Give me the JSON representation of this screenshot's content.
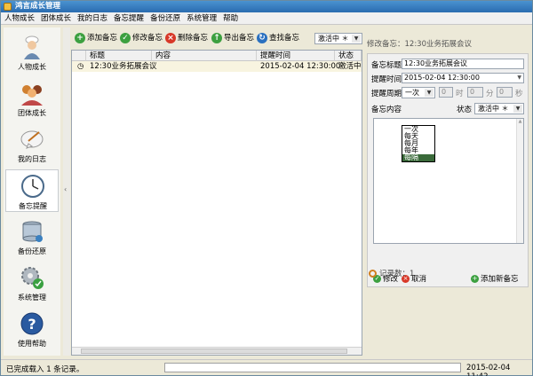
{
  "window": {
    "title": "鸿言成长管理"
  },
  "menu": [
    "人物成长",
    "团体成长",
    "我的日志",
    "备忘提醒",
    "备份还原",
    "系统管理",
    "帮助"
  ],
  "sidebar": [
    {
      "label": "人物成长",
      "icon": "person-icon"
    },
    {
      "label": "团体成长",
      "icon": "group-icon"
    },
    {
      "label": "我的日志",
      "icon": "diary-icon"
    },
    {
      "label": "备忘提醒",
      "icon": "clock-icon",
      "active": true
    },
    {
      "label": "备份还原",
      "icon": "database-icon"
    },
    {
      "label": "系统管理",
      "icon": "gear-icon"
    },
    {
      "label": "使用帮助",
      "icon": "help-icon"
    }
  ],
  "toolbar": {
    "add": "添加备忘",
    "edit": "修改备忘",
    "delete": "删除备忘",
    "export": "导出备忘",
    "find": "查找备忘",
    "filter": "激活中 ＊"
  },
  "table": {
    "columns": [
      "标题",
      "内容",
      "提醒时间",
      "状态"
    ],
    "rows": [
      {
        "title": "12:30业务拓展会议",
        "content": "",
        "time": "2015-02-04 12:30:00",
        "status": "激活中"
      }
    ]
  },
  "detail": {
    "header": "修改备忘：12:30业务拓展会议",
    "title_label": "备忘标题",
    "title_value": "12:30业务拓展会议",
    "time_label": "提醒时间",
    "time_value": "2015-02-04 12:30:00",
    "period_label": "提醒周期",
    "period_value": "一次",
    "day_value": "0",
    "day_unit": "时",
    "minute_value": "0",
    "minute_unit": "分",
    "second_value": "0",
    "second_unit": "秒",
    "content_label": "备忘内容",
    "status_label": "状态",
    "status_value": "激活中 ＊",
    "period_options": [
      "一次",
      "每天",
      "每月",
      "每年",
      "每隔"
    ],
    "edit_btn": "修改",
    "cancel_btn": "取消",
    "addnew_btn": "添加新备忘",
    "records": "记录数：1"
  },
  "status": {
    "left": "已完成载入 1 条记录。",
    "time": "2015-02-04 11:42"
  },
  "colors": {
    "accent_green": "#3ca040",
    "accent_red": "#d83828",
    "accent_blue": "#2a70c0"
  }
}
